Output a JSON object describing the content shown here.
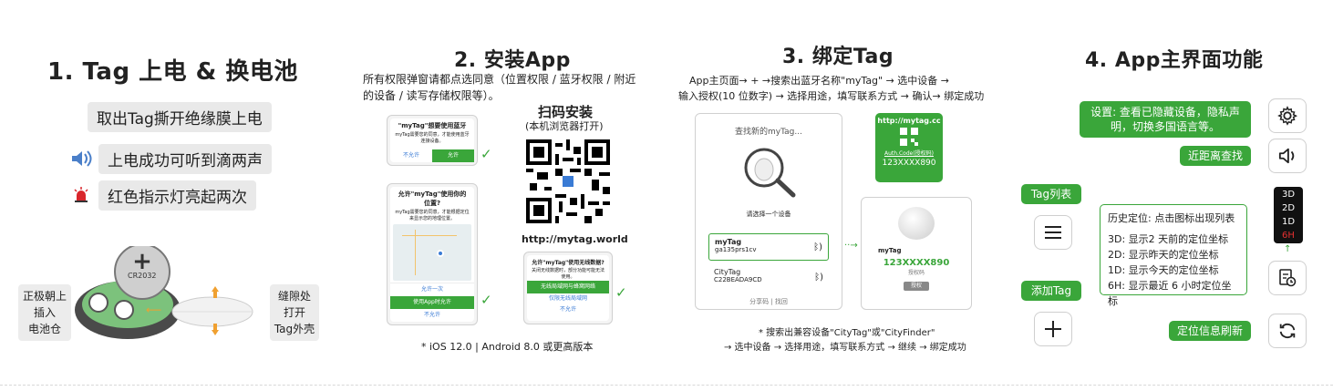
{
  "panel1": {
    "title": "1. Tag 上电 & 换电池",
    "step1": "取出Tag撕开绝缘膜上电",
    "step2": "上电成功可听到滴两声",
    "step3": "红色指示灯亮起两次",
    "battery_label": "CR2032",
    "left_label": [
      "正极朝上",
      "插入",
      "电池仓"
    ],
    "right_label": [
      "缝隙处",
      "打开",
      "Tag外壳"
    ]
  },
  "panel2": {
    "title": "2. 安装App",
    "desc": "所有权限弹窗请都点选同意（位置权限 / 蓝牙权限 / 附近的设备 / 读写存储权限等）。",
    "scan_title": "扫码安装",
    "scan_sub": "(本机浏览器打开)",
    "url": "http://mytag.world",
    "dialog1": {
      "title": "\"myTag\"想要使用蓝牙",
      "body": "myTag需要您的同意，才能使用蓝牙连接设备。",
      "deny": "不允许",
      "allow": "允许"
    },
    "dialog2": {
      "title": "允许\"myTag\"使用你的位置?",
      "body": "myTag需要您的同意，才能根据定位来显示您的地理位置。",
      "once": "允许一次",
      "while": "使用App时允许",
      "deny": "不允许"
    },
    "dialog3": {
      "title": "允许\"myTag\"使用无线数据?",
      "body": "关闭无线数据时，部分功能可能无法使用。",
      "wlan": "无线局域网与蜂窝网络",
      "wlan_only": "仅限无线局域网",
      "deny": "不允许"
    },
    "footnote": "* iOS 12.0 | Android 8.0 或更高版本"
  },
  "panel3": {
    "title": "3. 绑定Tag",
    "line1": "App主页面→ + →搜索出蓝牙名称\"myTag\" → 选中设备 →",
    "line2": "输入授权(10 位数字) → 选择用途，填写联系方式 → 确认→ 绑定成功",
    "search_title": "查找新的myTag...",
    "select_label": "请选择一个设备",
    "device1_name": "myTag",
    "device1_id": "ga135prs1cv",
    "device2_name": "CityTag",
    "device2_id": "C22BEADA9CD",
    "bottom_links": "分享码 | 找回",
    "auth_url": "http://mytag.cc",
    "auth_label": "Auth.Code(授权码)",
    "auth_code": "123XXXX890",
    "card_title": "myTag",
    "card_code": "123XXXX890",
    "card_sub": "授权码",
    "card_btn": "授权",
    "foot1": "* 搜索出兼容设备\"CityTag\"或\"CityFinder\"",
    "foot2": "→ 选中设备 → 选择用途，填写联系方式 → 继续 → 绑定成功"
  },
  "panel4": {
    "title": "4. App主界面功能",
    "settings_text": "设置: 查看已隐藏设备，隐私声明，切换多国语言等。",
    "nearby": "近距离查找",
    "taglist": "Tag列表",
    "add_tag": "添加Tag",
    "history_title": "历史定位: 点击图标出现列表",
    "h1": "3D: 显示2 天前的定位坐标",
    "h2": "2D: 显示昨天的定位坐标",
    "h3": "1D: 显示今天的定位坐标",
    "h4": "6H: 显示最近 6 小时定位坐标",
    "refresh": "定位信息刷新",
    "menu": [
      "3D",
      "2D",
      "1D",
      "6H"
    ]
  }
}
